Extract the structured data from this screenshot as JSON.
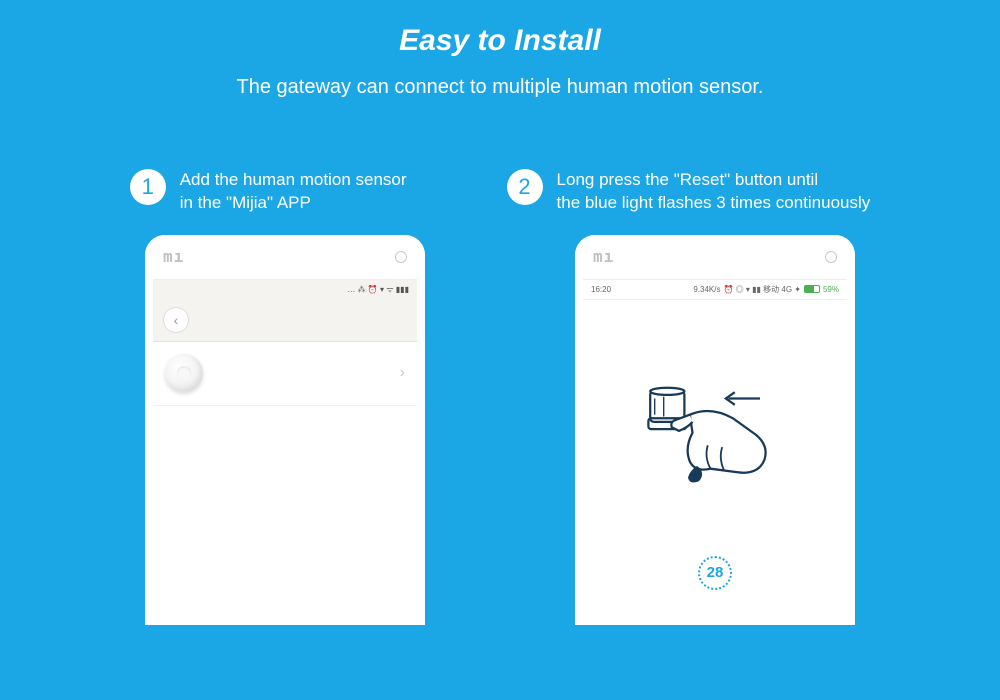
{
  "header": {
    "title": "Easy to Install",
    "subtitle": "The gateway can connect to multiple human motion sensor."
  },
  "steps": [
    {
      "num": "1",
      "line1": "Add the human motion sensor",
      "line2": " in the \"Mijia\" APP"
    },
    {
      "num": "2",
      "line1": "Long press the \"Reset\" button until",
      "line2": "the blue light flashes 3 times continuously"
    }
  ],
  "phone_logo": "mı",
  "phone1": {
    "statusbar": "… ⁂ ⏰ ▾ ᯤ ▮▮▮"
  },
  "phone2": {
    "time": "16:20",
    "speed": "9.34K/s",
    "icons": "⏰ ◎ ▾ ▮▮ 移动 4G ✦",
    "battery": "59%",
    "countdown": "28"
  }
}
